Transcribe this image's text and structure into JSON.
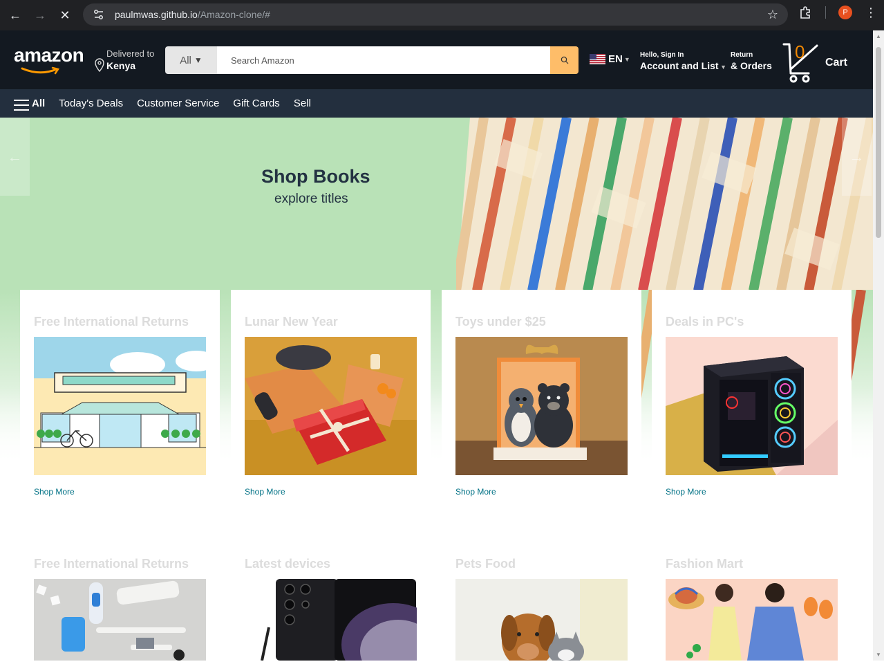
{
  "browser": {
    "url_host": "paulmwas.github.io",
    "url_path": "/Amazon-clone/#",
    "profile_initial": "P"
  },
  "header": {
    "logo": "amazon",
    "deliver_line1": "Delivered to",
    "deliver_line2": "Kenya",
    "search_category": "All",
    "search_placeholder": "Search Amazon",
    "language": "EN",
    "account_small": "Hello, Sign In",
    "account_big": "Account and List",
    "orders_small": "Return",
    "orders_big": "& Orders",
    "cart_count": "0",
    "cart_label": "Cart"
  },
  "subnav": {
    "all": "All",
    "items": [
      "Today's Deals",
      "Customer Service",
      "Gift Cards",
      "Sell"
    ]
  },
  "hero": {
    "title": "Shop Books",
    "subtitle": "explore titles"
  },
  "cards": [
    {
      "title": "Free International Returns",
      "link": "Shop More"
    },
    {
      "title": "Lunar New Year",
      "link": "Shop More"
    },
    {
      "title": "Toys under $25",
      "link": "Shop More"
    },
    {
      "title": "Deals in PC's",
      "link": "Shop More"
    },
    {
      "title": "Free International Returns",
      "link": ""
    },
    {
      "title": "Latest devices",
      "link": ""
    },
    {
      "title": "Pets Food",
      "link": ""
    },
    {
      "title": "Fashion Mart",
      "link": ""
    }
  ],
  "colors": {
    "header_bg": "#131921",
    "subnav_bg": "#232f3e",
    "search_button": "#febd69",
    "hero_green": "#b9e2b7",
    "link": "#007185"
  }
}
